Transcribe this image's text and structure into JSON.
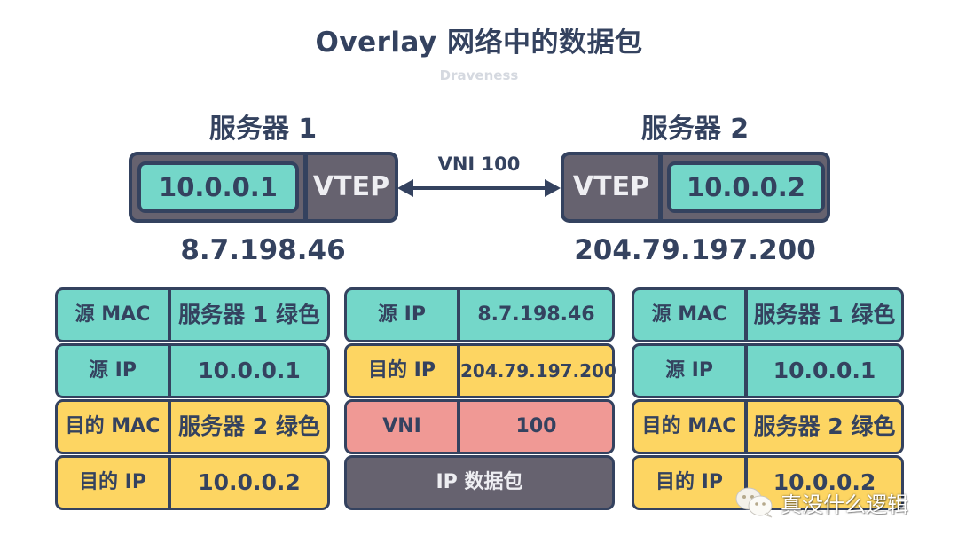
{
  "header": {
    "title": "Overlay 网络中的数据包",
    "subtitle": "Draveness"
  },
  "servers": [
    {
      "label": "服务器 1",
      "inner_ip": "10.0.0.1",
      "vtep_label": "VTEP",
      "public_ip": "8.7.198.46"
    },
    {
      "label": "服务器 2",
      "inner_ip": "10.0.0.2",
      "vtep_label": "VTEP",
      "public_ip": "204.79.197.200"
    }
  ],
  "link": {
    "label": "VNI 100",
    "direction": "bidirectional"
  },
  "colors": {
    "teal": "#74d7c9",
    "yellow": "#fdd562",
    "red": "#f09995",
    "dark": "#66626f",
    "outline": "#34425f",
    "subtitle": "#d5d9e0"
  },
  "packets": {
    "left": [
      {
        "key": "源 MAC",
        "value": "服务器 1 绿色",
        "color": "teal"
      },
      {
        "key": "源 IP",
        "value": "10.0.0.1",
        "color": "teal"
      },
      {
        "key": "目的 MAC",
        "value": "服务器 2 绿色",
        "color": "yellow"
      },
      {
        "key": "目的 IP",
        "value": "10.0.0.2",
        "color": "yellow"
      }
    ],
    "center": [
      {
        "key": "源 IP",
        "value": "8.7.198.46",
        "color": "teal"
      },
      {
        "key": "目的 IP",
        "value": "204.79.197.200",
        "color": "yellow"
      },
      {
        "key": "VNI",
        "value": "100",
        "color": "red"
      },
      {
        "full": "IP 数据包",
        "color": "dark"
      }
    ],
    "right": [
      {
        "key": "源 MAC",
        "value": "服务器 1 绿色",
        "color": "teal"
      },
      {
        "key": "源 IP",
        "value": "10.0.0.1",
        "color": "teal"
      },
      {
        "key": "目的 MAC",
        "value": "服务器 2 绿色",
        "color": "yellow"
      },
      {
        "key": "目的 IP",
        "value": "10.0.0.2",
        "color": "yellow"
      }
    ]
  },
  "watermark": {
    "icon": "wechat-icon",
    "text": "真没什么逻辑"
  }
}
